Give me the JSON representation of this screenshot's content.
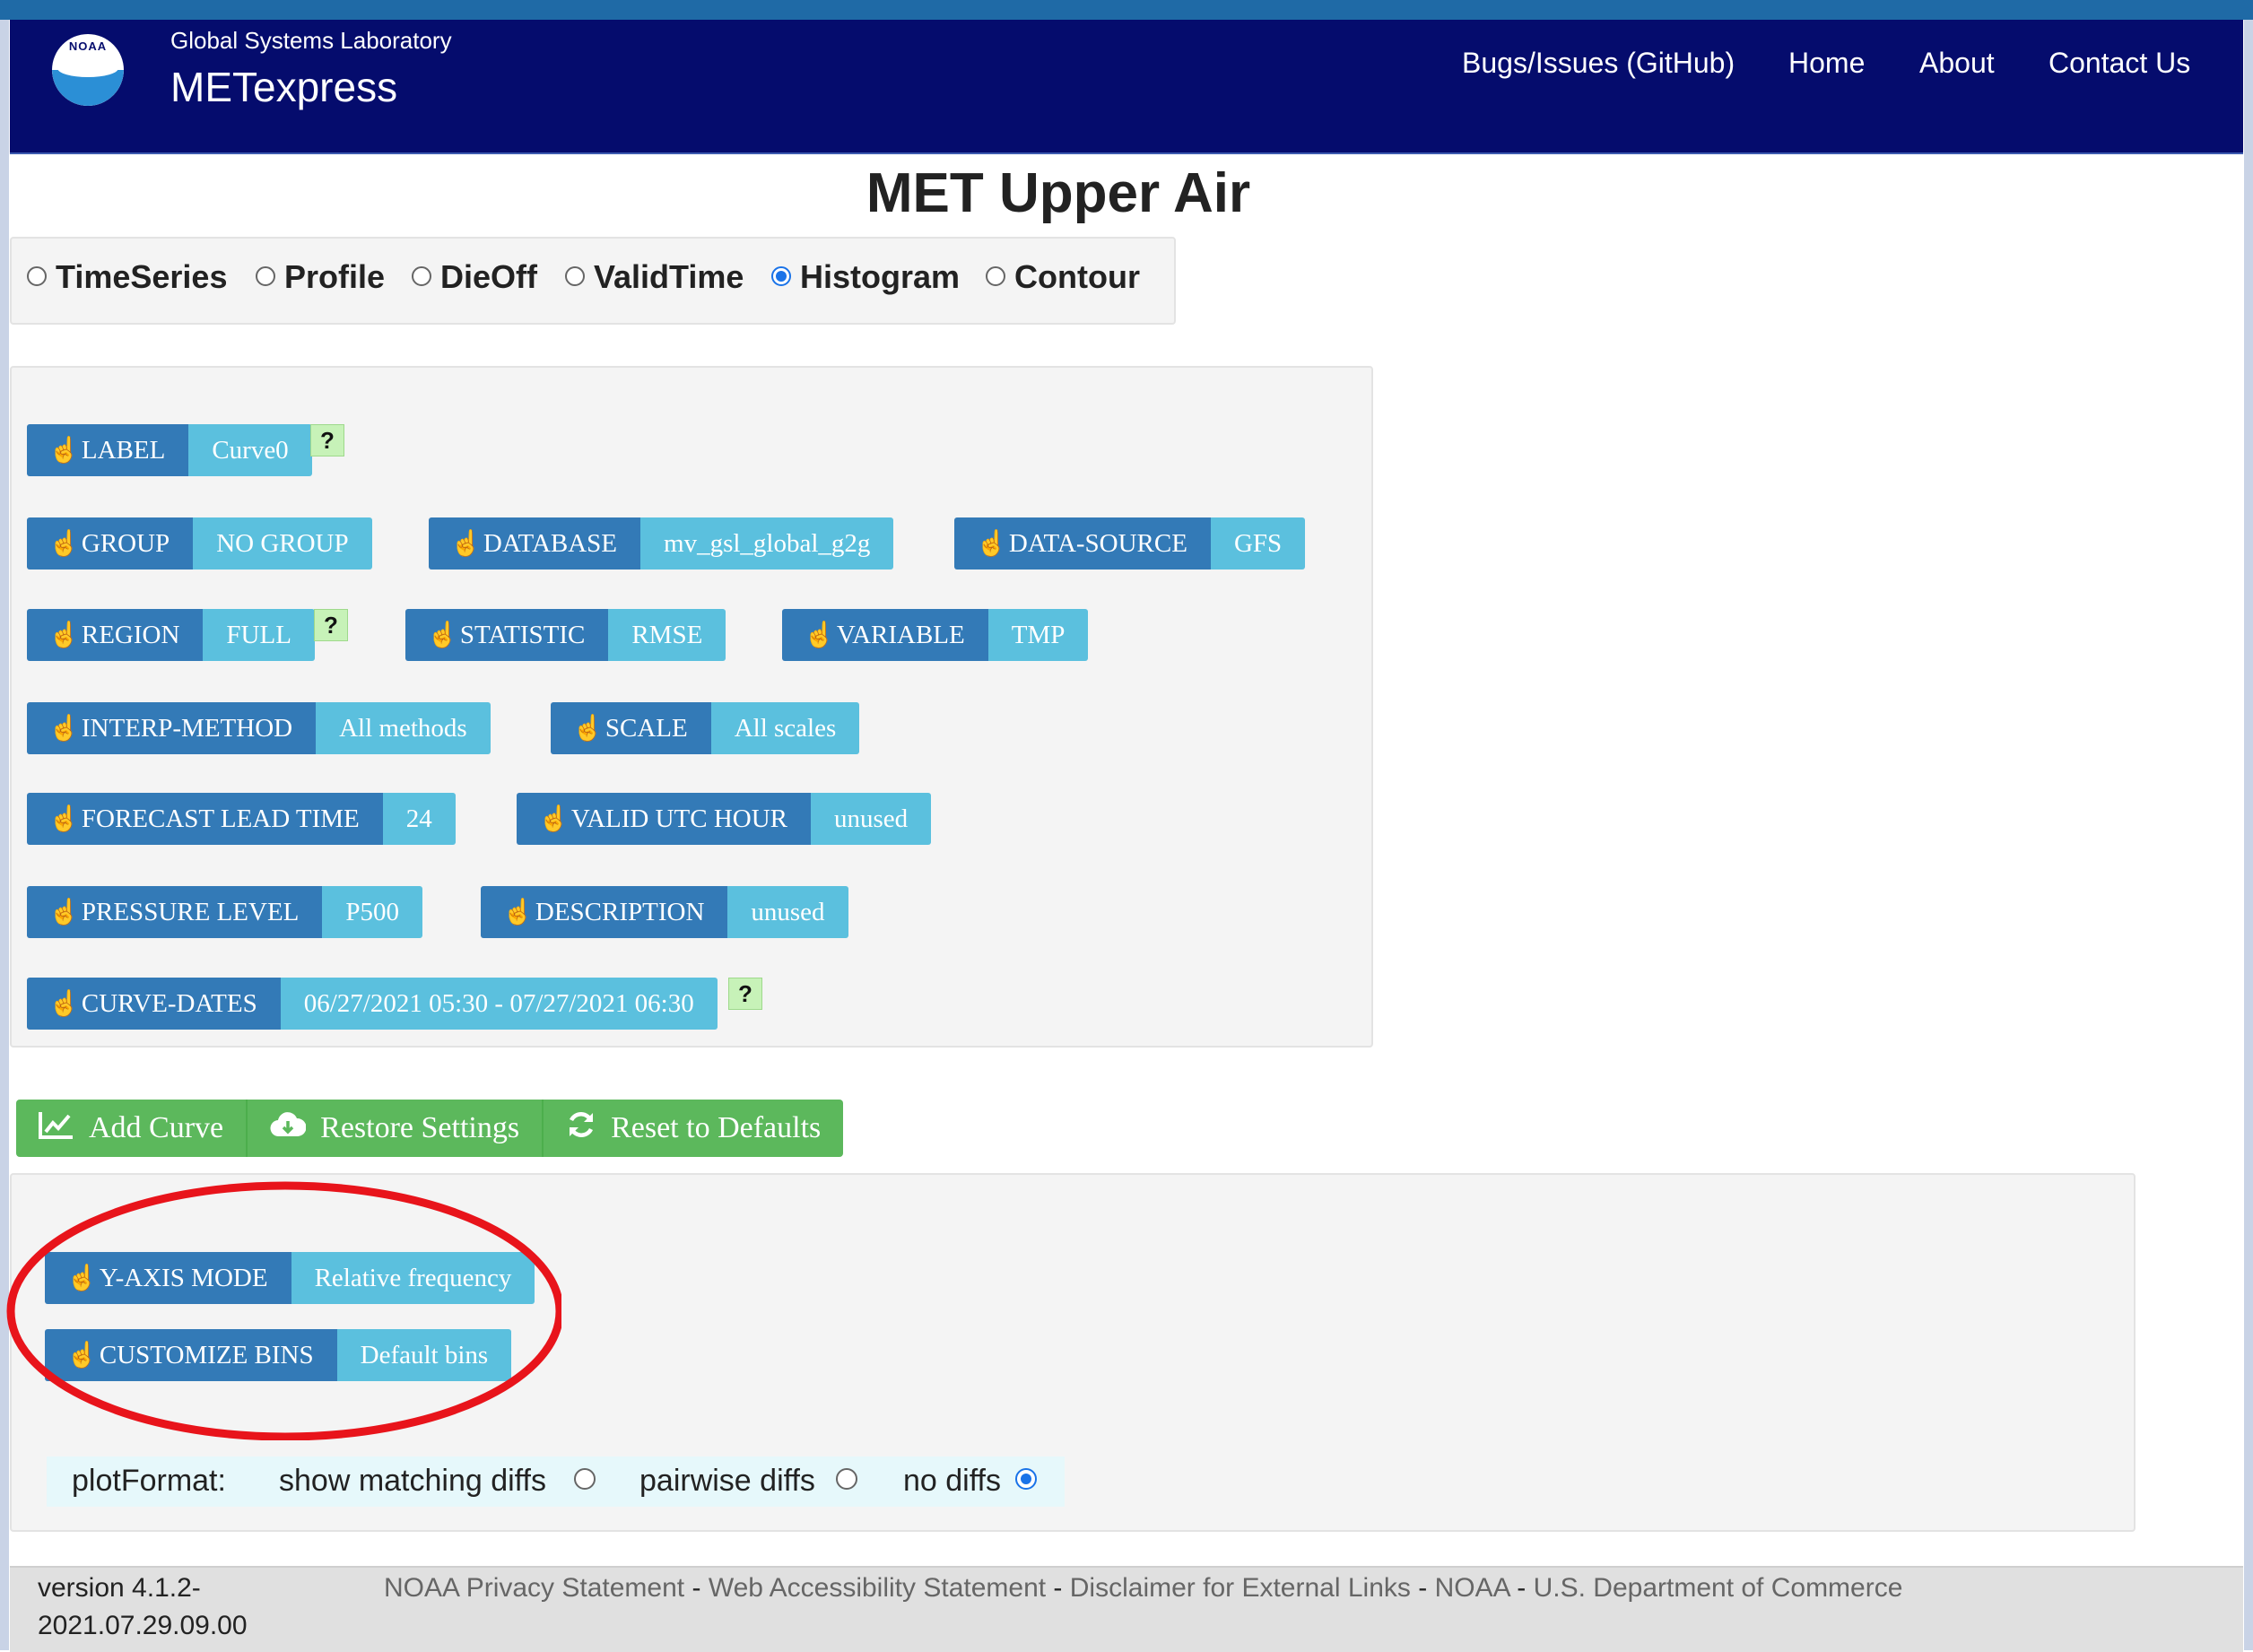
{
  "header": {
    "lab_name": "Global Systems Laboratory",
    "app_name": "METexpress",
    "logo_text": "NOAA",
    "nav": [
      "Bugs/Issues (GitHub)",
      "Home",
      "About",
      "Contact Us"
    ]
  },
  "page_title": "MET Upper Air",
  "plot_types": {
    "options": [
      "TimeSeries",
      "Profile",
      "DieOff",
      "ValidTime",
      "Histogram",
      "Contour"
    ],
    "selected": "Histogram"
  },
  "curve_params": {
    "label": {
      "key": "LABEL",
      "value": "Curve0"
    },
    "group": {
      "key": "GROUP",
      "value": "NO GROUP"
    },
    "database": {
      "key": "DATABASE",
      "value": "mv_gsl_global_g2g"
    },
    "data_source": {
      "key": "DATA-SOURCE",
      "value": "GFS"
    },
    "region": {
      "key": "REGION",
      "value": "FULL"
    },
    "statistic": {
      "key": "STATISTIC",
      "value": "RMSE"
    },
    "variable": {
      "key": "VARIABLE",
      "value": "TMP"
    },
    "interp_method": {
      "key": "INTERP-METHOD",
      "value": "All methods"
    },
    "scale": {
      "key": "SCALE",
      "value": "All scales"
    },
    "forecast_lead": {
      "key": "FORECAST LEAD TIME",
      "value": "24"
    },
    "valid_utc_hour": {
      "key": "VALID UTC HOUR",
      "value": "unused"
    },
    "pressure_level": {
      "key": "PRESSURE LEVEL",
      "value": "P500"
    },
    "description": {
      "key": "DESCRIPTION",
      "value": "unused"
    },
    "curve_dates": {
      "key": "CURVE-DATES",
      "value": "06/27/2021 05:30 - 07/27/2021 06:30"
    },
    "help_label": "?"
  },
  "actions": {
    "add_curve": "Add Curve",
    "restore": "Restore Settings",
    "reset": "Reset to Defaults"
  },
  "plot_params": {
    "y_axis_mode": {
      "key": "Y-AXIS MODE",
      "value": "Relative frequency"
    },
    "customize_bins": {
      "key": "CUSTOMIZE BINS",
      "value": "Default bins"
    },
    "plot_format_label": "plotFormat:",
    "plot_format_options": [
      "show matching diffs",
      "pairwise diffs",
      "no diffs"
    ],
    "plot_format_selected": "no diffs"
  },
  "highlight_color": "#e8141b",
  "colors": {
    "navbar": "#050c6d",
    "selector_key": "#337ab7",
    "selector_value": "#5bc0de",
    "action_green": "#5cb85c",
    "radio_selected": "#1a73e8"
  },
  "footer": {
    "version_line1": "version 4.1.2-",
    "version_line2": "2021.07.29.09.00",
    "links": [
      "NOAA Privacy Statement",
      "Web Accessibility Statement",
      "Disclaimer for External Links",
      "NOAA",
      "U.S. Department of Commerce"
    ],
    "separator": " - "
  }
}
